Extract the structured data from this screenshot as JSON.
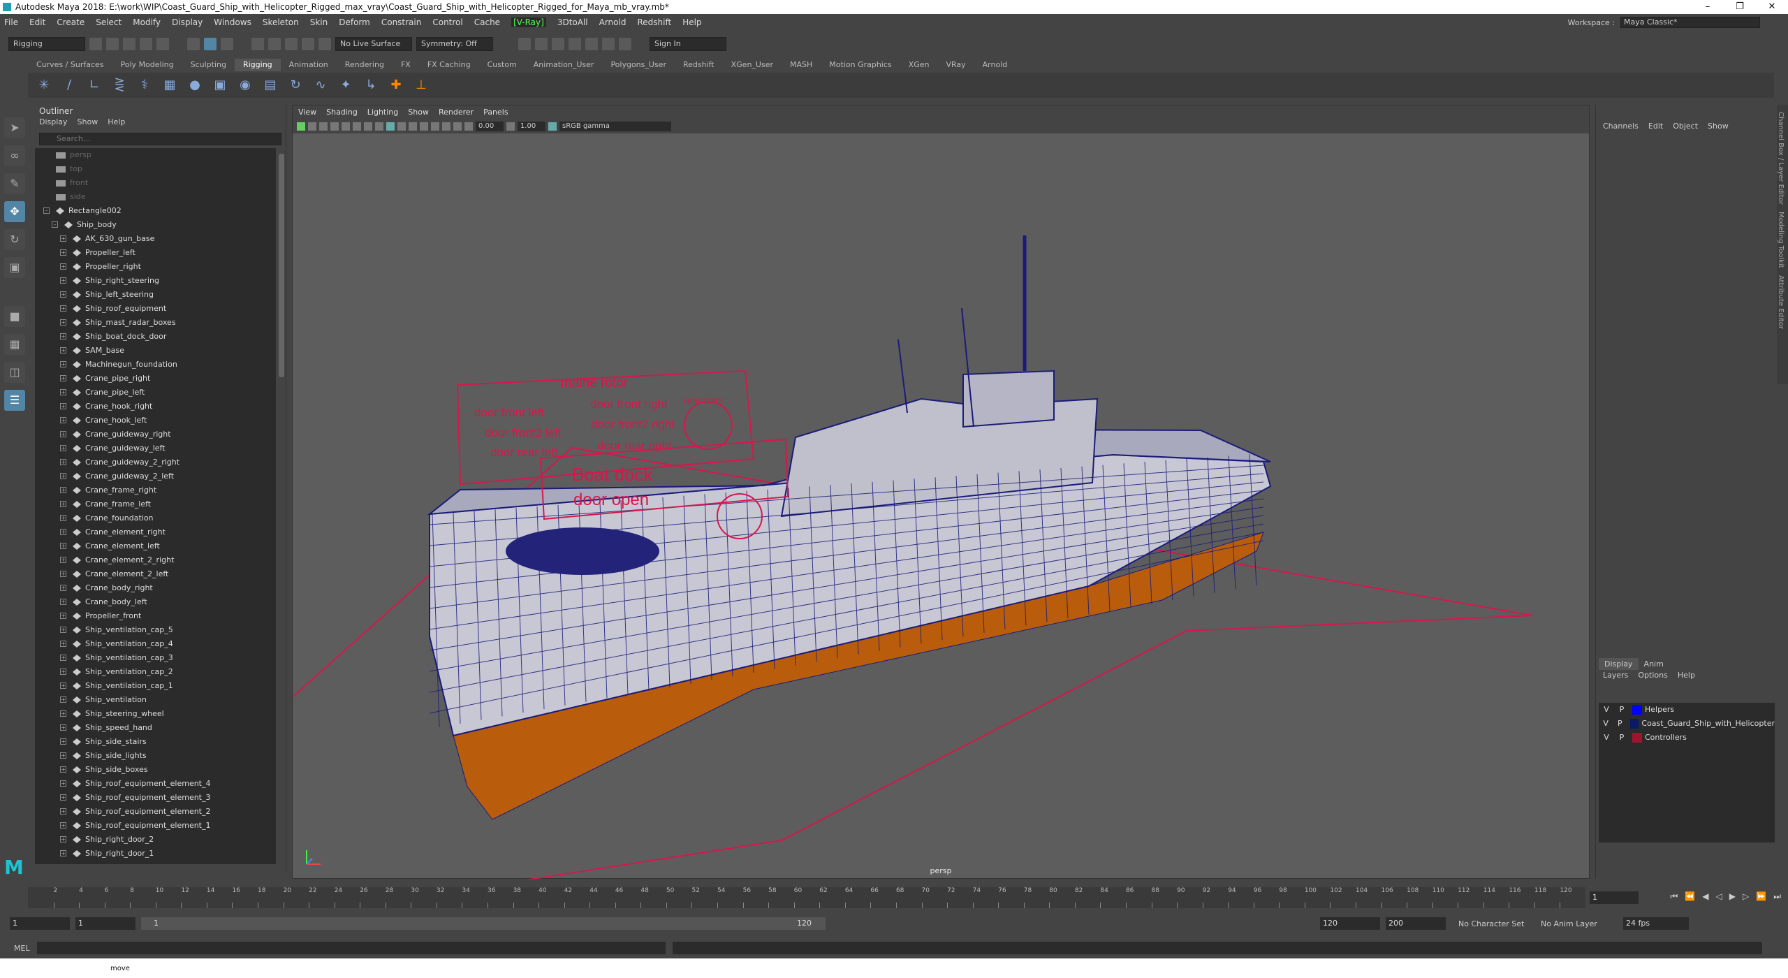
{
  "title": "Autodesk Maya 2018: E:\\work\\WIP\\Coast_Guard_Ship_with_Helicopter_Rigged_max_vray\\Coast_Guard_Ship_with_Helicopter_Rigged_for_Maya_mb_vray.mb*",
  "menus": [
    "File",
    "Edit",
    "Create",
    "Select",
    "Modify",
    "Display",
    "Windows",
    "Skeleton",
    "Skin",
    "Deform",
    "Constrain",
    "Control",
    "Cache",
    "[V-Ray]",
    "3DtoAll",
    "Arnold",
    "Redshift",
    "Help"
  ],
  "workspace": {
    "label": "Workspace :",
    "value": "Maya Classic*"
  },
  "status": {
    "mode": "Rigging",
    "symmetry": "Symmetry: Off",
    "live": "No Live Surface",
    "signin": "Sign In"
  },
  "shelf_tabs": [
    "Curves / Surfaces",
    "Poly Modeling",
    "Sculpting",
    "Rigging",
    "Animation",
    "Rendering",
    "FX",
    "FX Caching",
    "Custom",
    "Animation_User",
    "Polygons_User",
    "Redshift",
    "XGen_User",
    "MASH",
    "Motion Graphics",
    "XGen",
    "VRay",
    "Arnold"
  ],
  "outliner": {
    "title": "Outliner",
    "menus": [
      "Display",
      "Show",
      "Help"
    ],
    "search": "Search...",
    "cams": [
      "persp",
      "top",
      "front",
      "side"
    ],
    "group": "Rectangle002",
    "body": "Ship_body",
    "items": [
      "AK_630_gun_base",
      "Propeller_left",
      "Propeller_right",
      "Ship_right_steering",
      "Ship_left_steering",
      "Ship_roof_equipment",
      "Ship_mast_radar_boxes",
      "Ship_boat_dock_door",
      "SAM_base",
      "Machinegun_foundation",
      "Crane_pipe_right",
      "Crane_pipe_left",
      "Crane_hook_right",
      "Crane_hook_left",
      "Crane_guideway_right",
      "Crane_guideway_left",
      "Crane_guideway_2_right",
      "Crane_guideway_2_left",
      "Crane_frame_right",
      "Crane_frame_left",
      "Crane_foundation",
      "Crane_element_right",
      "Crane_element_left",
      "Crane_element_2_right",
      "Crane_element_2_left",
      "Crane_body_right",
      "Crane_body_left",
      "Propeller_front",
      "Ship_ventilation_cap_5",
      "Ship_ventilation_cap_4",
      "Ship_ventilation_cap_3",
      "Ship_ventilation_cap_2",
      "Ship_ventilation_cap_1",
      "Ship_ventilation",
      "Ship_steering_wheel",
      "Ship_speed_hand",
      "Ship_side_stairs",
      "Ship_side_lights",
      "Ship_side_boxes",
      "Ship_roof_equipment_element_4",
      "Ship_roof_equipment_element_3",
      "Ship_roof_equipment_element_2",
      "Ship_roof_equipment_element_1",
      "Ship_right_door_2",
      "Ship_right_door_1"
    ]
  },
  "viewport": {
    "menus": [
      "View",
      "Shading",
      "Lighting",
      "Show",
      "Renderer",
      "Panels"
    ],
    "exposure": "0.00",
    "gamma": "1.00",
    "colorspace": "sRGB gamma",
    "camera": "persp",
    "labels": {
      "main": "maine rotor",
      "f1": "door front left",
      "f2": "door front right",
      "f3": "door front2 left",
      "f4": "door front2 right",
      "f5": "door rear left",
      "f6": "door rear right",
      "rear": "rear rotor",
      "dock1": "Boat dock",
      "dock2": "door open"
    }
  },
  "channel": {
    "menus": [
      "Channels",
      "Edit",
      "Object",
      "Show"
    ],
    "tabs": [
      "Display",
      "Anim"
    ],
    "lmenus": [
      "Layers",
      "Options",
      "Help"
    ],
    "layers": [
      {
        "v": "V",
        "p": "P",
        "color": "#0000ff",
        "name": "Helpers"
      },
      {
        "v": "V",
        "p": "P",
        "color": "#0b1a66",
        "name": "Coast_Guard_Ship_with_Helicopter"
      },
      {
        "v": "V",
        "p": "P",
        "color": "#a0142c",
        "name": "Controllers"
      }
    ]
  },
  "side_tabs": [
    "Channel Box / Layer Editor",
    "Modeling Toolkit",
    "Attribute Editor"
  ],
  "time": {
    "ticks": [
      "2",
      "4",
      "6",
      "8",
      "10",
      "12",
      "14",
      "16",
      "18",
      "20",
      "22",
      "24",
      "26",
      "28",
      "30",
      "32",
      "34",
      "36",
      "38",
      "40",
      "42",
      "44",
      "46",
      "48",
      "50",
      "52",
      "54",
      "56",
      "58",
      "60",
      "62",
      "64",
      "66",
      "68",
      "70",
      "72",
      "74",
      "76",
      "78",
      "80",
      "82",
      "84",
      "86",
      "88",
      "90",
      "92",
      "94",
      "96",
      "98",
      "100",
      "102",
      "104",
      "106",
      "108",
      "110",
      "112",
      "114",
      "116",
      "118",
      "120"
    ],
    "current": "1",
    "start": "1",
    "start2": "1",
    "rangeStart": "1",
    "rangeEnd": "120",
    "end": "120",
    "end2": "200",
    "charset": "No Character Set",
    "animlayer": "No Anim Layer",
    "fps": "24 fps"
  },
  "cmd": {
    "lang": "MEL"
  },
  "help": "move"
}
